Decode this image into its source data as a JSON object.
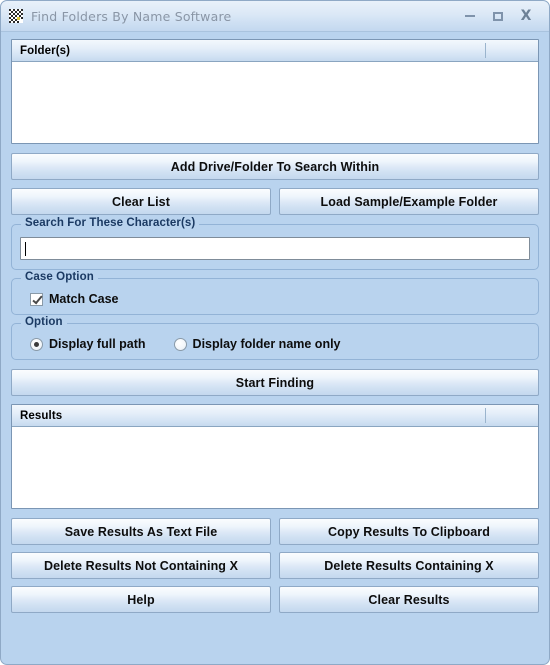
{
  "window": {
    "title": "Find Folders By Name Software",
    "icon": "app-folder-search-icon",
    "minimize_label": "–",
    "maximize_label": "□",
    "close_label": "X",
    "background_color": "#b9d3ee",
    "titlebar_text_color": "#8a96a6"
  },
  "folders_list": {
    "header": "Folder(s)",
    "rows": []
  },
  "buttons": {
    "add_drive_folder": "Add Drive/Folder To Search Within",
    "clear_list": "Clear List",
    "load_sample": "Load Sample/Example Folder",
    "start_finding": "Start Finding",
    "save_results": "Save Results As Text File",
    "copy_results": "Copy Results To Clipboard",
    "delete_not_containing": "Delete Results Not Containing X",
    "delete_containing": "Delete Results Containing X",
    "help": "Help",
    "clear_results": "Clear Results"
  },
  "search_group": {
    "title": "Search For These Character(s)",
    "input_value": "",
    "input_placeholder": ""
  },
  "case_group": {
    "title": "Case Option",
    "match_case_label": "Match Case",
    "match_case_checked": true
  },
  "option_group": {
    "title": "Option",
    "options": [
      {
        "label": "Display full path",
        "selected": true
      },
      {
        "label": "Display folder name only",
        "selected": false
      }
    ]
  },
  "results_list": {
    "header": "Results",
    "rows": []
  }
}
